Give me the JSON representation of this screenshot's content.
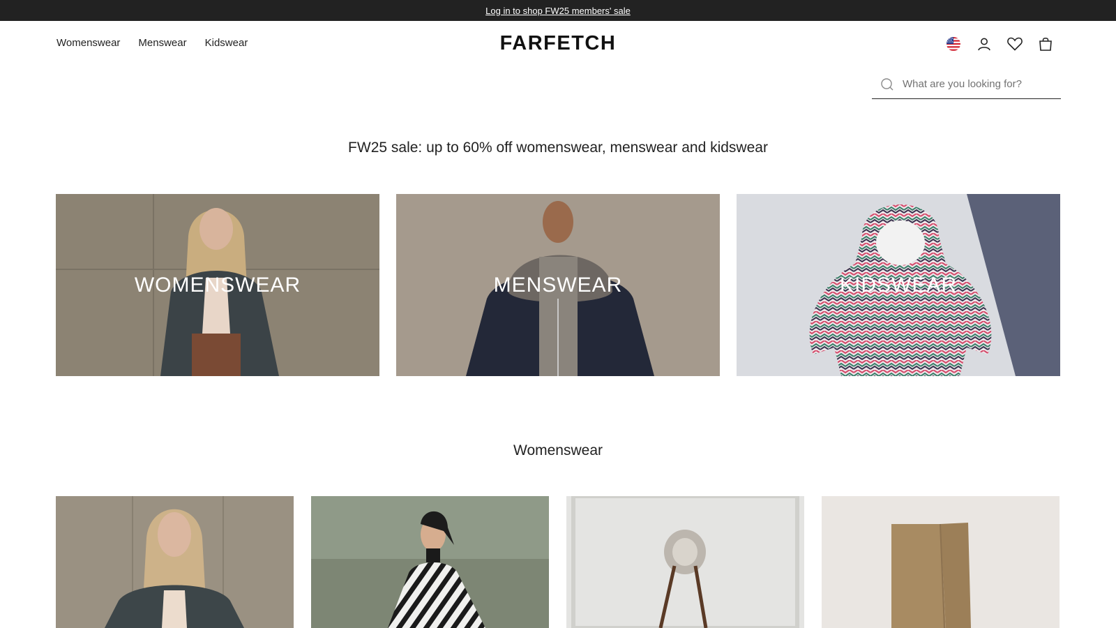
{
  "promo": {
    "text": "Log in to shop FW25 members' sale"
  },
  "nav": {
    "items": [
      {
        "label": "Womenswear"
      },
      {
        "label": "Menswear"
      },
      {
        "label": "Kidswear"
      }
    ]
  },
  "logo": {
    "text": "FARFETCH"
  },
  "header_icons": [
    "us-flag-icon",
    "account-icon",
    "heart-icon",
    "bag-icon"
  ],
  "search": {
    "placeholder": "What are you looking for?"
  },
  "headline": "FW25 sale: up to 60% off womenswear, menswear and kidswear",
  "category_tiles": [
    {
      "label": "WOMENSWEAR"
    },
    {
      "label": "MENSWEAR"
    },
    {
      "label": "KIDSWEAR"
    }
  ],
  "womenswear_section": {
    "title": "Womenswear"
  },
  "colors": {
    "promo_bg": "#222222",
    "text": "#222222",
    "white": "#ffffff"
  }
}
